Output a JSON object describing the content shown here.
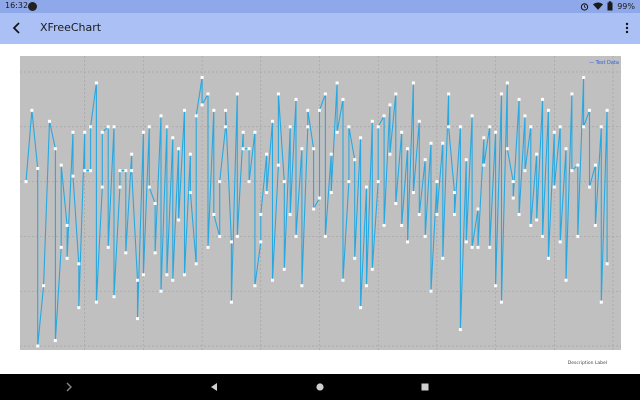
{
  "status_bar": {
    "time": "16:32",
    "battery": "99%",
    "icons": [
      "notification-icon",
      "alarm-icon",
      "wifi-icon",
      "battery-icon"
    ]
  },
  "app_bar": {
    "title": "XFreeChart",
    "back_icon": "arrow-back-icon",
    "menu_icon": "more-vert-icon"
  },
  "colors": {
    "status_bar": "#8fa8e9",
    "app_bar": "#abc0f5",
    "plot_background": "#c0c0c0",
    "series": "#29a8e0",
    "grid": "#9a9a9a"
  },
  "chart_data": {
    "type": "line",
    "title": "",
    "xlabel": "Description Label",
    "ylabel": "",
    "grid": true,
    "legend_position": "top-right",
    "xlim": [
      0,
      100
    ],
    "ylim": [
      0,
      250
    ],
    "series": [
      {
        "name": "Test Data",
        "points": [
          [
            0,
            150
          ],
          [
            1,
            215
          ],
          [
            2,
            162
          ],
          [
            2,
            0
          ],
          [
            3,
            55
          ],
          [
            4,
            205
          ],
          [
            5,
            180
          ],
          [
            5,
            5
          ],
          [
            6,
            90
          ],
          [
            6,
            165
          ],
          [
            7,
            110
          ],
          [
            7,
            80
          ],
          [
            8,
            195
          ],
          [
            8,
            155
          ],
          [
            9,
            75
          ],
          [
            9,
            35
          ],
          [
            10,
            195
          ],
          [
            10,
            160
          ],
          [
            11,
            160
          ],
          [
            11,
            200
          ],
          [
            12,
            240
          ],
          [
            12,
            40
          ],
          [
            13,
            145
          ],
          [
            13,
            195
          ],
          [
            14,
            200
          ],
          [
            14,
            90
          ],
          [
            15,
            200
          ],
          [
            15,
            45
          ],
          [
            16,
            145
          ],
          [
            16,
            160
          ],
          [
            17,
            160
          ],
          [
            17,
            85
          ],
          [
            18,
            175
          ],
          [
            18,
            160
          ],
          [
            19,
            60
          ],
          [
            19,
            25
          ],
          [
            20,
            195
          ],
          [
            20,
            65
          ],
          [
            21,
            200
          ],
          [
            21,
            145
          ],
          [
            22,
            130
          ],
          [
            22,
            85
          ],
          [
            23,
            210
          ],
          [
            23,
            50
          ],
          [
            24,
            200
          ],
          [
            24,
            65
          ],
          [
            25,
            190
          ],
          [
            25,
            60
          ],
          [
            26,
            180
          ],
          [
            26,
            115
          ],
          [
            27,
            215
          ],
          [
            27,
            65
          ],
          [
            28,
            175
          ],
          [
            28,
            140
          ],
          [
            29,
            75
          ],
          [
            29,
            210
          ],
          [
            30,
            245
          ],
          [
            30,
            220
          ],
          [
            31,
            230
          ],
          [
            31,
            90
          ],
          [
            32,
            215
          ],
          [
            32,
            120
          ],
          [
            33,
            100
          ],
          [
            33,
            150
          ],
          [
            34,
            200
          ],
          [
            34,
            215
          ],
          [
            35,
            95
          ],
          [
            35,
            40
          ],
          [
            36,
            230
          ],
          [
            36,
            100
          ],
          [
            37,
            195
          ],
          [
            37,
            180
          ],
          [
            38,
            180
          ],
          [
            38,
            150
          ],
          [
            39,
            195
          ],
          [
            39,
            55
          ],
          [
            40,
            95
          ],
          [
            40,
            120
          ],
          [
            41,
            175
          ],
          [
            41,
            140
          ],
          [
            42,
            205
          ],
          [
            42,
            60
          ],
          [
            43,
            165
          ],
          [
            43,
            230
          ],
          [
            44,
            150
          ],
          [
            44,
            70
          ],
          [
            45,
            200
          ],
          [
            45,
            120
          ],
          [
            46,
            225
          ],
          [
            46,
            100
          ],
          [
            47,
            180
          ],
          [
            47,
            55
          ],
          [
            48,
            200
          ],
          [
            48,
            215
          ],
          [
            49,
            180
          ],
          [
            49,
            125
          ],
          [
            50,
            135
          ],
          [
            50,
            215
          ],
          [
            51,
            230
          ],
          [
            51,
            100
          ],
          [
            52,
            175
          ],
          [
            52,
            140
          ],
          [
            53,
            240
          ],
          [
            53,
            195
          ],
          [
            54,
            225
          ],
          [
            54,
            60
          ],
          [
            55,
            150
          ],
          [
            55,
            200
          ],
          [
            56,
            170
          ],
          [
            56,
            80
          ],
          [
            57,
            190
          ],
          [
            57,
            35
          ],
          [
            58,
            145
          ],
          [
            58,
            55
          ],
          [
            59,
            205
          ],
          [
            59,
            70
          ],
          [
            60,
            150
          ],
          [
            60,
            200
          ],
          [
            61,
            210
          ],
          [
            61,
            110
          ],
          [
            62,
            220
          ],
          [
            62,
            175
          ],
          [
            63,
            230
          ],
          [
            63,
            130
          ],
          [
            64,
            195
          ],
          [
            64,
            110
          ],
          [
            65,
            180
          ],
          [
            65,
            95
          ],
          [
            66,
            240
          ],
          [
            66,
            140
          ],
          [
            67,
            205
          ],
          [
            67,
            120
          ],
          [
            68,
            170
          ],
          [
            68,
            100
          ],
          [
            69,
            185
          ],
          [
            69,
            50
          ],
          [
            70,
            150
          ],
          [
            70,
            120
          ],
          [
            71,
            185
          ],
          [
            71,
            80
          ],
          [
            72,
            230
          ],
          [
            72,
            200
          ],
          [
            73,
            140
          ],
          [
            73,
            120
          ],
          [
            74,
            200
          ],
          [
            74,
            15
          ],
          [
            75,
            170
          ],
          [
            75,
            95
          ],
          [
            76,
            210
          ],
          [
            76,
            90
          ],
          [
            77,
            125
          ],
          [
            77,
            90
          ],
          [
            78,
            190
          ],
          [
            78,
            165
          ],
          [
            79,
            200
          ],
          [
            79,
            90
          ],
          [
            80,
            195
          ],
          [
            80,
            55
          ],
          [
            81,
            230
          ],
          [
            81,
            40
          ],
          [
            82,
            240
          ],
          [
            82,
            180
          ],
          [
            83,
            150
          ],
          [
            83,
            135
          ],
          [
            84,
            225
          ],
          [
            84,
            120
          ],
          [
            85,
            210
          ],
          [
            85,
            160
          ],
          [
            86,
            200
          ],
          [
            86,
            110
          ],
          [
            87,
            175
          ],
          [
            87,
            115
          ],
          [
            88,
            225
          ],
          [
            88,
            100
          ],
          [
            89,
            215
          ],
          [
            89,
            80
          ],
          [
            90,
            195
          ],
          [
            90,
            145
          ],
          [
            91,
            200
          ],
          [
            91,
            95
          ],
          [
            92,
            180
          ],
          [
            92,
            60
          ],
          [
            93,
            230
          ],
          [
            93,
            160
          ],
          [
            94,
            165
          ],
          [
            94,
            100
          ],
          [
            95,
            245
          ],
          [
            95,
            200
          ],
          [
            96,
            215
          ],
          [
            96,
            145
          ],
          [
            97,
            165
          ],
          [
            97,
            110
          ],
          [
            98,
            200
          ],
          [
            98,
            40
          ],
          [
            99,
            215
          ],
          [
            99,
            75
          ]
        ]
      }
    ]
  }
}
